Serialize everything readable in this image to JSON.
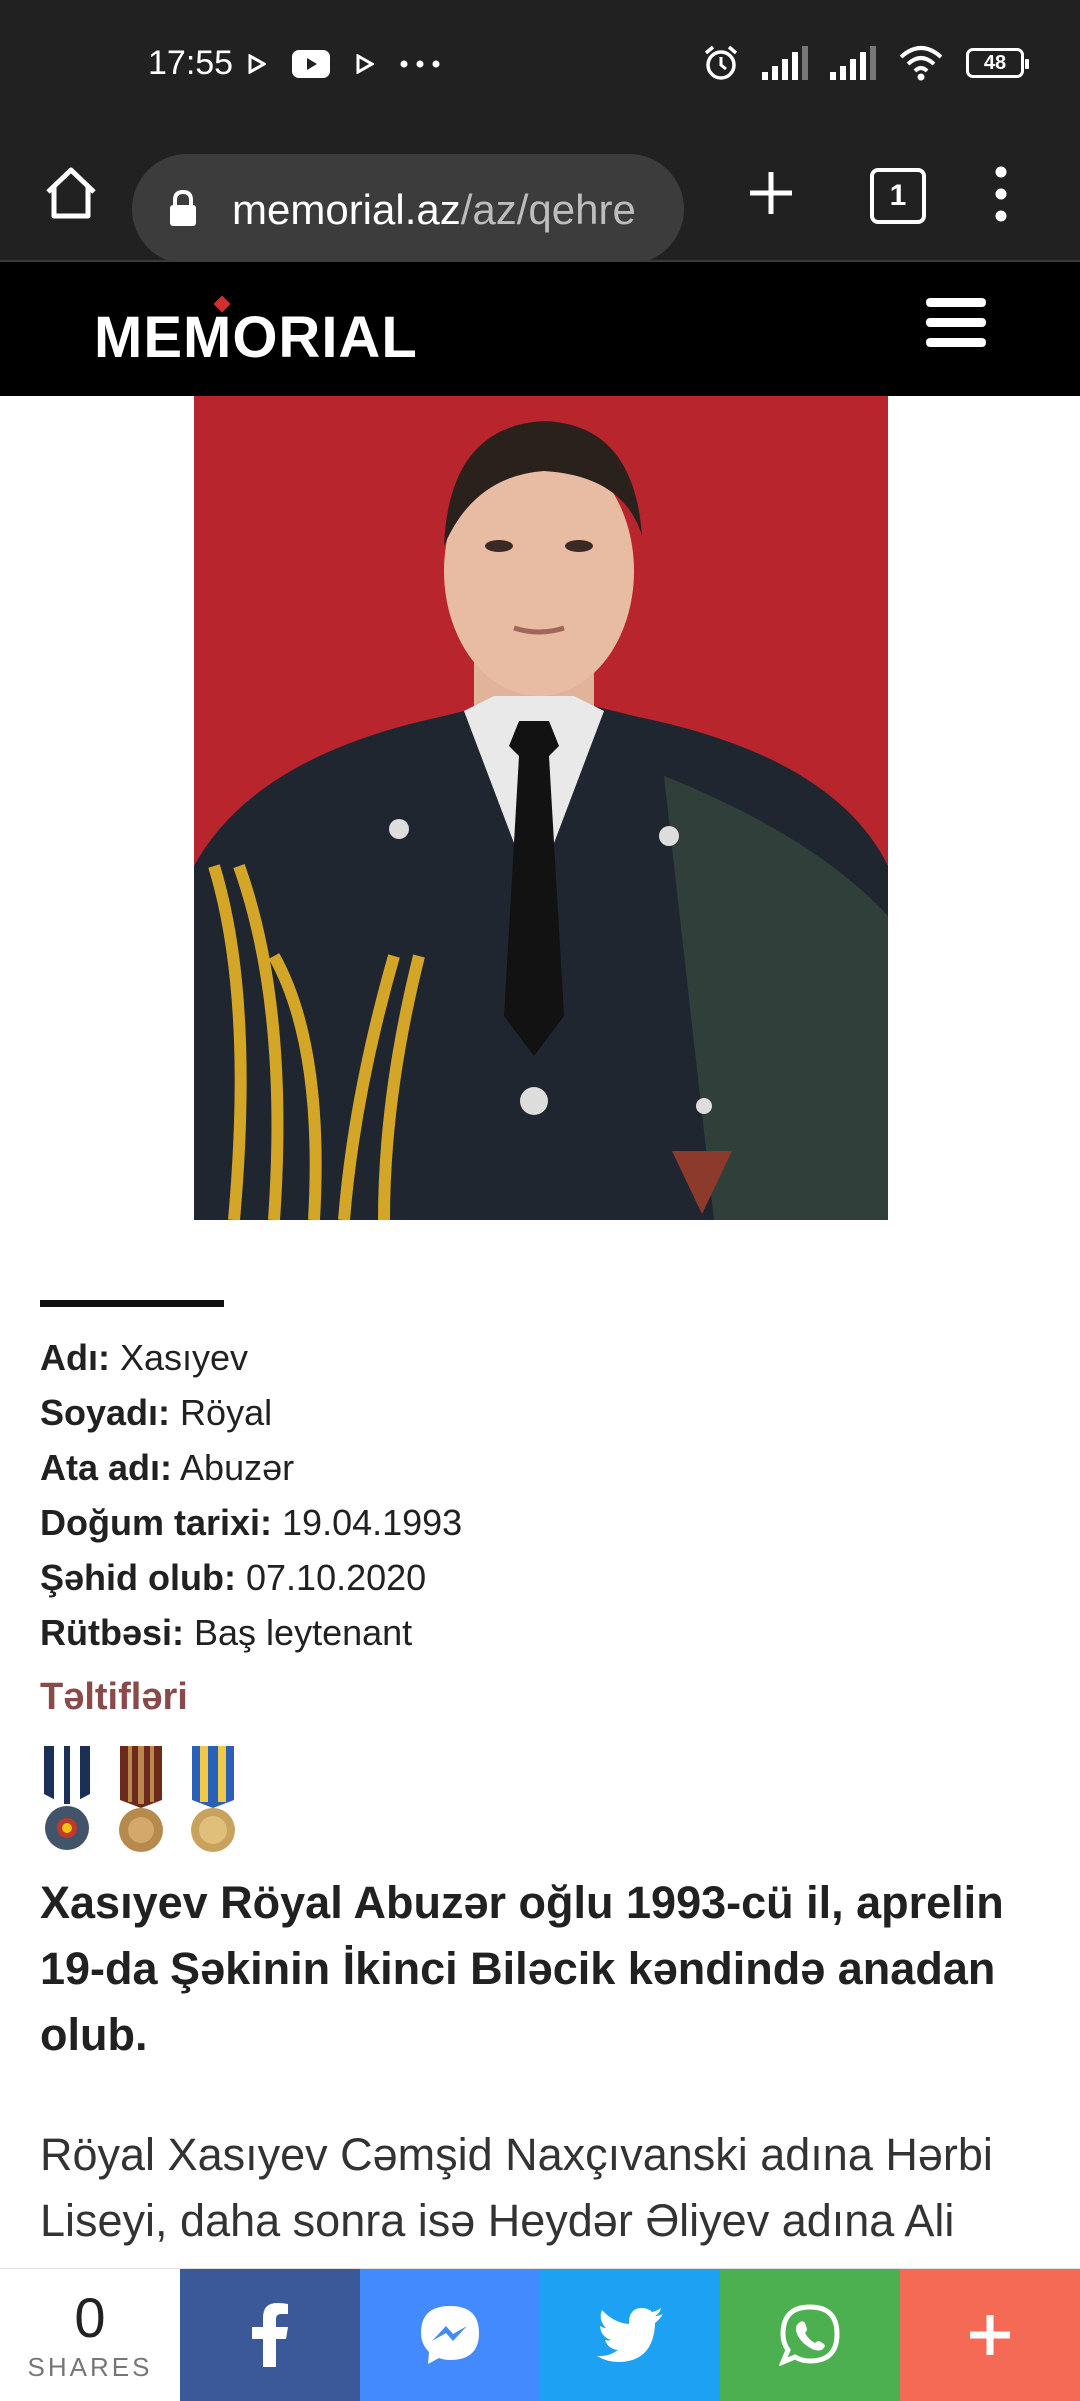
{
  "status_bar": {
    "time": "17:55",
    "battery": "48",
    "icons": [
      "play-icon",
      "youtube-icon",
      "play-icon",
      "more-dots-icon",
      "alarm-icon",
      "signal-icon",
      "signal-icon",
      "wifi-icon",
      "battery-icon"
    ]
  },
  "browser": {
    "url_domain": "memorial.az",
    "url_path": "/az/qehre",
    "tab_count": "1"
  },
  "site": {
    "logo": "MEMORIAL"
  },
  "profile": {
    "fields": [
      {
        "label": "Adı:",
        "value": "Xasıyev"
      },
      {
        "label": "Soyadı:",
        "value": "Röyal"
      },
      {
        "label": "Ata adı:",
        "value": "Abuzər"
      },
      {
        "label": "Doğum tarixi:",
        "value": "19.04.1993"
      },
      {
        "label": "Şəhid olub:",
        "value": "07.10.2020"
      },
      {
        "label": "Rütbəsi:",
        "value": "Baş leytenant"
      }
    ],
    "awards_title": "Təltifləri",
    "headline": "Xasıyev Röyal Abuzər oğlu 1993-cü il, aprelin 19-da Şəkinin İkinci Biləcik kəndində anadan olub.",
    "body": "Röyal Xasıyev Cəmşid Naxçıvanski adına Hərbi Liseyi, daha sonra isə Heydər Əliyev adına Ali"
  },
  "share_bar": {
    "count": "0",
    "label": "SHARES",
    "buttons": [
      {
        "name": "facebook",
        "color": "#3b5998"
      },
      {
        "name": "messenger",
        "color": "#448aff"
      },
      {
        "name": "twitter",
        "color": "#1da1f2"
      },
      {
        "name": "whatsapp",
        "color": "#4caf50"
      },
      {
        "name": "more",
        "color": "#f46a54"
      }
    ]
  }
}
